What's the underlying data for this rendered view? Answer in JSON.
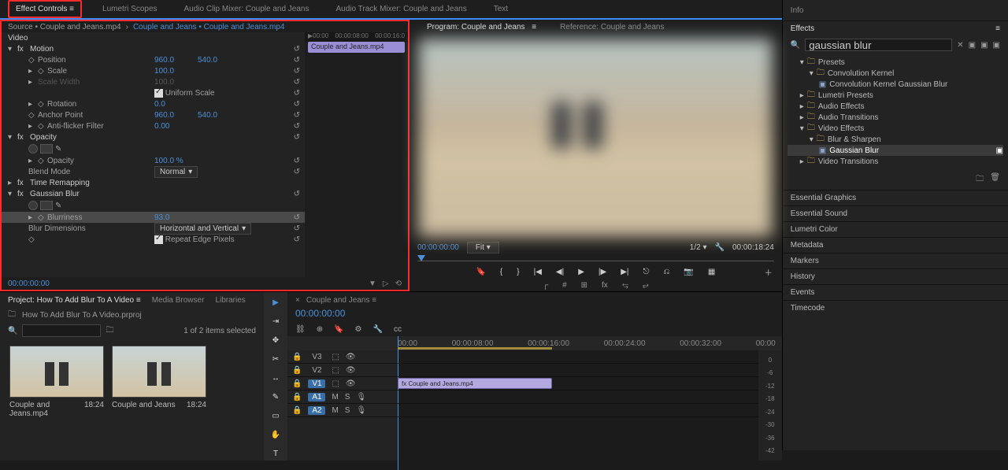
{
  "colors": {
    "accent": "#4b90d8",
    "highlight": "#ff2a2a",
    "clip": "#b3a9e0"
  },
  "topTabs": {
    "effectControls": "Effect Controls",
    "lumetri": "Lumetri Scopes",
    "audioClip": "Audio Clip Mixer: Couple and Jeans",
    "audioTrack": "Audio Track Mixer: Couple and Jeans",
    "text": "Text"
  },
  "source": {
    "label": "Source • Couple and Jeans.mp4",
    "masterLabel": "Couple and Jeans • Couple and Jeans.mp4"
  },
  "miniRuler": [
    "▶00:00",
    "00:00:08:00",
    "00:00:16:0"
  ],
  "miniClip": "Couple and Jeans.mp4",
  "ec": {
    "videoLabel": "Video",
    "motion": {
      "title": "Motion",
      "position": "Position",
      "positionX": "960.0",
      "positionY": "540.0",
      "scale": "Scale",
      "scaleVal": "100.0",
      "scaleWidth": "Scale Width",
      "scaleWidthVal": "100.0",
      "uniform": "Uniform Scale",
      "rotation": "Rotation",
      "rotationVal": "0.0",
      "anchor": "Anchor Point",
      "anchorX": "960.0",
      "anchorY": "540.0",
      "antiFlicker": "Anti-flicker Filter",
      "antiFlickerVal": "0.00"
    },
    "opacity": {
      "title": "Opacity",
      "label": "Opacity",
      "val": "100.0 %",
      "blend": "Blend Mode",
      "blendVal": "Normal"
    },
    "timeRemap": "Time Remapping",
    "gauss": {
      "title": "Gaussian Blur",
      "blurriness": "Blurriness",
      "blurrinessVal": "93.0",
      "dims": "Blur Dimensions",
      "dimsVal": "Horizontal and Vertical",
      "repeat": "Repeat Edge Pixels"
    }
  },
  "ecFootTime": "00:00:00:00",
  "program": {
    "tab": "Program: Couple and Jeans",
    "refTab": "Reference: Couple and Jeans",
    "tcIn": "00:00:00:00",
    "fit": "Fit",
    "fraction": "1/2",
    "tcOut": "00:00:18:24"
  },
  "project": {
    "tab": "Project: How To Add Blur To A Video",
    "media": "Media Browser",
    "libs": "Libraries",
    "file": "How To Add Blur To A Video.prproj",
    "status": "1 of 2 items selected",
    "searchPlaceholder": "",
    "thumbs": [
      {
        "name": "Couple and Jeans.mp4",
        "dur": "18:24"
      },
      {
        "name": "Couple and Jeans",
        "dur": "18:24"
      }
    ]
  },
  "timeline": {
    "seq": "Couple and Jeans",
    "tc": "00:00:00:00",
    "ruler": [
      "00:00",
      "00:00:08:00",
      "00:00:16:00",
      "00:00:24:00",
      "00:00:32:00",
      "00:00"
    ],
    "tracks": {
      "v3": "V3",
      "v2": "V2",
      "v1": "V1",
      "a1": "A1",
      "a2": "A2",
      "m": "M",
      "s": "S"
    },
    "clip": "Couple and Jeans.mp4"
  },
  "db": [
    "0",
    "-6",
    "-12",
    "-18",
    "-24",
    "-30",
    "-36",
    "-42"
  ],
  "right": {
    "info": "Info",
    "effects": "Effects",
    "searchVal": "gaussian blur",
    "tree": {
      "presets": "Presets",
      "ck": "Convolution Kernel",
      "ckg": "Convolution Kernel Gaussian Blur",
      "lumetriPresets": "Lumetri Presets",
      "audioEffects": "Audio Effects",
      "audioTransitions": "Audio Transitions",
      "videoEffects": "Video Effects",
      "blurSharpen": "Blur & Sharpen",
      "gaussianBlur": "Gaussian Blur",
      "videoTransitions": "Video Transitions"
    },
    "panels": [
      "Essential Graphics",
      "Essential Sound",
      "Lumetri Color",
      "Metadata",
      "Markers",
      "History",
      "Events",
      "Timecode"
    ]
  }
}
